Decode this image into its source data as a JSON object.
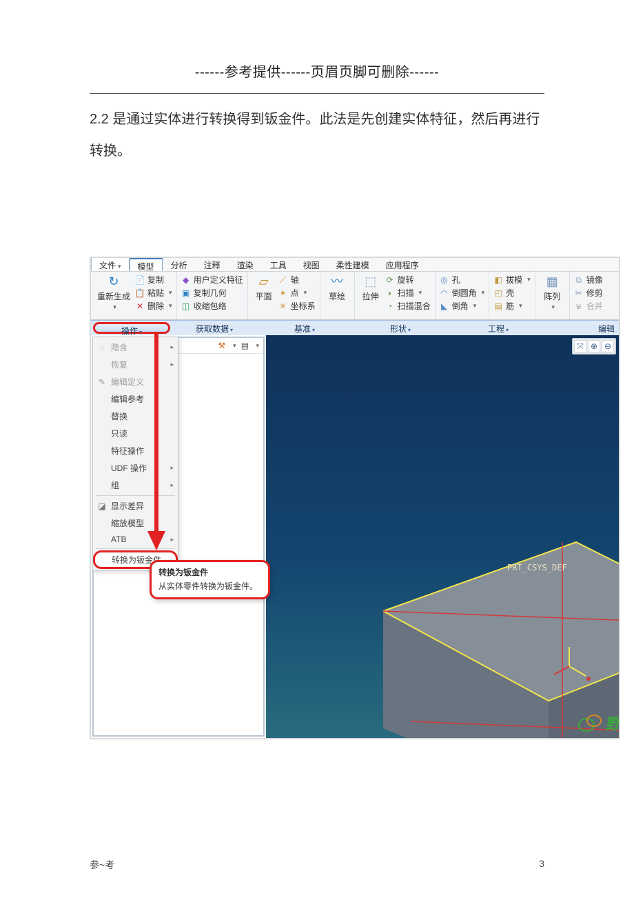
{
  "doc": {
    "header": "------参考提供------页眉页脚可删除------",
    "body_p1": "2.2 是通过实体进行转换得到钣金件。此法是先创建实体特征，然后再进行转换。",
    "footer_left": "参~考",
    "footer_right": "3"
  },
  "tabs": {
    "file": "文件",
    "items": [
      "模型",
      "分析",
      "注释",
      "渲染",
      "工具",
      "视图",
      "柔性建模",
      "应用程序"
    ]
  },
  "ribbon": {
    "group_regen": {
      "big": "重新生成",
      "copy": "复制",
      "paste": "粘贴",
      "delete": "删除"
    },
    "group_user": {
      "udf": "用户定义特征",
      "copygeom": "复制几何",
      "shrink": "收缩包络"
    },
    "group_plane": {
      "plane": "平面",
      "axis": "轴",
      "point": "点",
      "csys": "坐标系"
    },
    "group_sketch": {
      "sketch": "草绘"
    },
    "group_ext": {
      "extrude": "拉伸",
      "revolve": "旋转",
      "sweep": "扫描",
      "swept_blend": "扫描混合"
    },
    "group_hole": {
      "hole": "孔",
      "round": "倒圆角",
      "chamfer": "倒角"
    },
    "group_draft": {
      "draft": "拔模",
      "shell": "壳",
      "rib": "筋"
    },
    "group_pattern": {
      "pattern": "阵列"
    },
    "group_mirror": {
      "mirror": "镜像",
      "trim": "修剪",
      "merge": "合并"
    }
  },
  "subgroups": {
    "ops": "操作",
    "getdata": "获取数据",
    "datum": "基准",
    "shapes": "形状",
    "engineering": "工程",
    "edit": "编辑"
  },
  "op_menu": {
    "hide": "隐含",
    "resume": "恢复",
    "editdef": "编辑定义",
    "editref": "编辑参考",
    "replace": "替换",
    "readonly": "只读",
    "featops": "特征操作",
    "udfops": "UDF 操作",
    "group": "组",
    "diff": "显示差异",
    "scale": "缩放模型",
    "atb": "ATB",
    "to_sheetmetal": "转换为钣金件"
  },
  "tooltip": {
    "title": "转换为钣金件",
    "desc": "从实体零件转换为钣金件。"
  },
  "viewport": {
    "csys_label": "PRT_CSYS_DEF"
  },
  "watermark": {
    "text": "野"
  }
}
